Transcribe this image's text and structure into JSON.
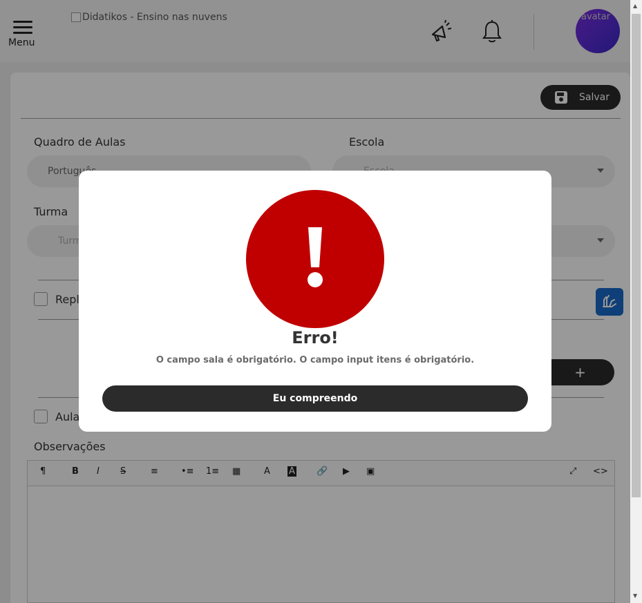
{
  "header": {
    "menu_label": "Menu",
    "logo_alt": "Didatikos - Ensino nas nuvens",
    "avatar_alt": "avatar"
  },
  "toolbar": {
    "save_label": "Salvar",
    "add_label": "+"
  },
  "form": {
    "quadro_label": "Quadro de Aulas",
    "quadro_value": "Português",
    "escola_label": "Escola",
    "escola_placeholder": "Escola",
    "turma_label": "Turma",
    "turma_placeholder": "Turma",
    "replicar_label": "Repl",
    "aula_label": "Aula",
    "observacoes_label": "Observações"
  },
  "editor_tools": [
    "¶",
    "B",
    "I",
    "S",
    "≡",
    "•≡",
    "1≡",
    "▦",
    "A",
    "A",
    "🔗",
    "▶",
    "▣",
    "⤢",
    "<>"
  ],
  "modal": {
    "title": "Erro!",
    "message": "O campo sala é obrigatório. O campo input itens é obrigatório.",
    "confirm_label": "Eu compreendo"
  },
  "colors": {
    "error": "#c00000",
    "dark_button": "#2b2b2b",
    "libras_blue": "#1a69c9",
    "avatar_gradient": "#7a2ce0"
  }
}
